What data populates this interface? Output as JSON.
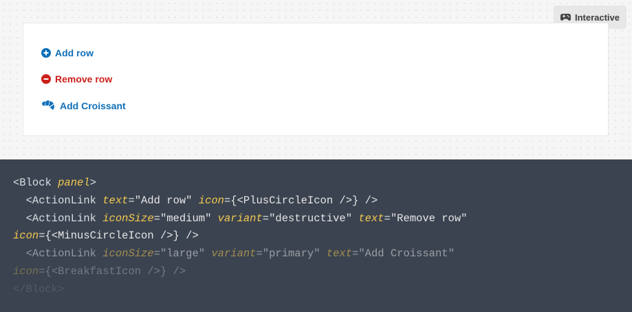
{
  "badge": {
    "label": "Interactive",
    "icon": "gamepad-icon"
  },
  "actions": [
    {
      "label": "Add row",
      "icon": "plus-circle-icon",
      "color": "#0f6fb9"
    },
    {
      "label": "Remove row",
      "icon": "minus-circle-icon",
      "color": "#cc1f1a"
    },
    {
      "label": "Add Croissant",
      "icon": "croissant-icon",
      "color": "#0f6fb9"
    }
  ],
  "code": {
    "l1_open": "<Block ",
    "l1_attr": "panel",
    "l1_close": ">",
    "l2_a": "  <ActionLink ",
    "l2_attr1": "text",
    "l2_v1": "=\"Add row\" ",
    "l2_attr2": "icon",
    "l2_v2": "={<PlusCircleIcon />} />",
    "l3_a": "  <ActionLink ",
    "l3_attr1": "iconSize",
    "l3_v1": "=\"medium\" ",
    "l3_attr2": "variant",
    "l3_v2": "=\"destructive\" ",
    "l3_attr3": "text",
    "l3_v3": "=\"Remove row\"",
    "l4_attr": "icon",
    "l4_v": "={<MinusCircleIcon />} />",
    "l5_a": "  <ActionLink ",
    "l5_attr1": "iconSize",
    "l5_v1": "=\"large\" ",
    "l5_attr2": "variant",
    "l5_v2": "=\"primary\" ",
    "l5_attr3": "text",
    "l5_v3": "=\"Add Croissant\"",
    "l6_attr": "icon",
    "l6_v": "={<BreakfastIcon />} />",
    "l7": "</Block>"
  }
}
